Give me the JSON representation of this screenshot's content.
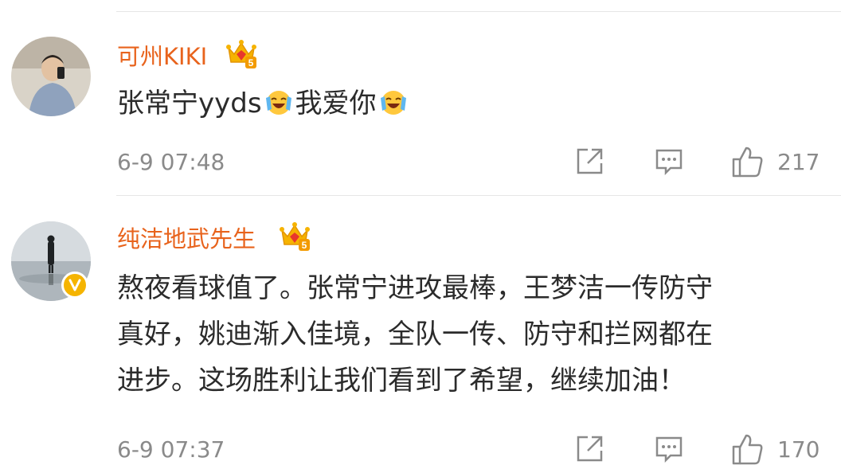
{
  "comments": [
    {
      "username": "可州KIKI",
      "text_part1": "张常宁yyds",
      "text_part2": "我爱你",
      "time": "6-9 07:48",
      "likes": "217"
    },
    {
      "username": "纯洁地武先生",
      "text_line1": "熬夜看球值了。张常宁进攻最棒，王梦洁一传防守",
      "text_line2": "真好，姚迪渐入佳境，全队一传、防守和拦网都在",
      "text_line3": "进步。这场胜利让我们看到了希望，继续加油！",
      "time": "6-9 07:37",
      "likes": "170"
    }
  ],
  "icons": {
    "crown": "crown-level-5-icon",
    "emoji": "laughing-tears-emoji-icon",
    "verified": "verified-v-badge-icon",
    "share": "share-icon",
    "comment": "comment-icon",
    "like": "thumbs-up-icon"
  },
  "colors": {
    "username": "#e8631c",
    "meta": "#8a8a8a",
    "text": "#2b2b2b",
    "verified": "#f5b400"
  }
}
